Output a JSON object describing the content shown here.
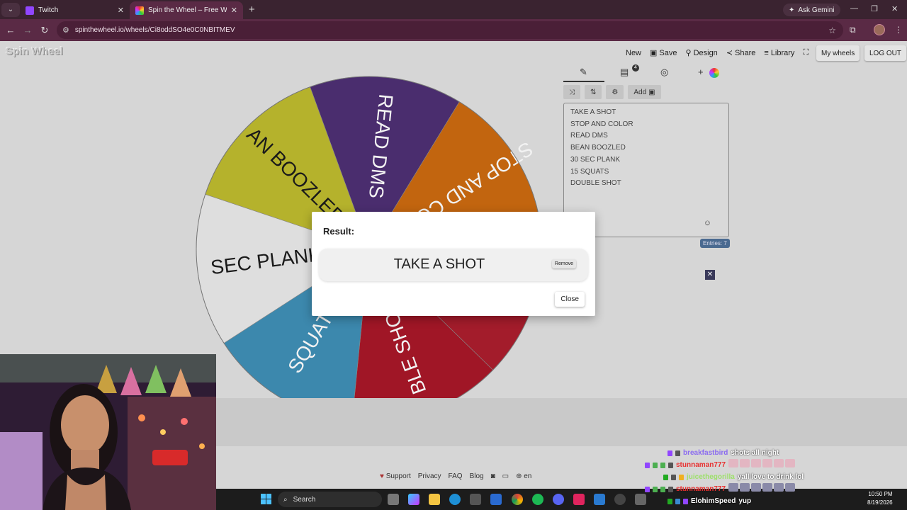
{
  "browser": {
    "tabs": [
      {
        "title": "Twitch"
      },
      {
        "title": "Spin the Wheel – Free Wheel Sp"
      }
    ],
    "ask_gemini": "Ask Gemini",
    "url": "spinthewheel.io/wheels/Ci8oddSO4e0C0NBITMEV"
  },
  "site": {
    "logo": "Spin Wheel",
    "nav": {
      "new": "New",
      "save": "Save",
      "design": "Design",
      "share": "Share",
      "library": "Library"
    },
    "my_wheels": "My wheels",
    "logout": "LOG OUT",
    "add_label": "Add",
    "notif_count": "4",
    "entries": [
      "TAKE A SHOT",
      "STOP AND COLOR",
      "READ DMS",
      "BEAN BOOZLED",
      "30 SEC PLANK",
      "15 SQUATS",
      "DOUBLE SHOT"
    ],
    "entries_count": "Entries: 7"
  },
  "wheel": {
    "segments": [
      {
        "label": "READ DMS",
        "color": "#4a2d6e"
      },
      {
        "label": "STOP AND COLOR",
        "color": "#c2650f"
      },
      {
        "label": "",
        "color": "#a31c2b"
      },
      {
        "label": "BLE SHOT",
        "color": "#a01626"
      },
      {
        "label": "SQUATS",
        "color": "#3c88ad"
      },
      {
        "label": "SEC PLANK",
        "color": "#dedede"
      },
      {
        "label": "AN BOOZLED",
        "color": "#b5b22c"
      }
    ]
  },
  "modal": {
    "title": "Result:",
    "result": "TAKE A SHOT",
    "remove": "Remove",
    "close": "Close"
  },
  "footer": {
    "support": "Support",
    "privacy": "Privacy",
    "faq": "FAQ",
    "blog": "Blog",
    "lang": "en"
  },
  "taskbar": {
    "search": "Search",
    "time": "10:50 PM",
    "date": "8/19/2026"
  },
  "chat": [
    {
      "user": "breakfastbird",
      "message": "shots all night",
      "color": "#8a6af0"
    },
    {
      "user": "stunnaman777",
      "message": "",
      "color": "#e83030"
    },
    {
      "user": "juicethegorilla",
      "message": "yall love to drink lol",
      "color": "#9de06a"
    },
    {
      "user": "stunnaman777",
      "message": "",
      "color": "#e83030"
    },
    {
      "user": "ElohimSpeed",
      "message": "yup",
      "color": "#ffffff"
    }
  ]
}
